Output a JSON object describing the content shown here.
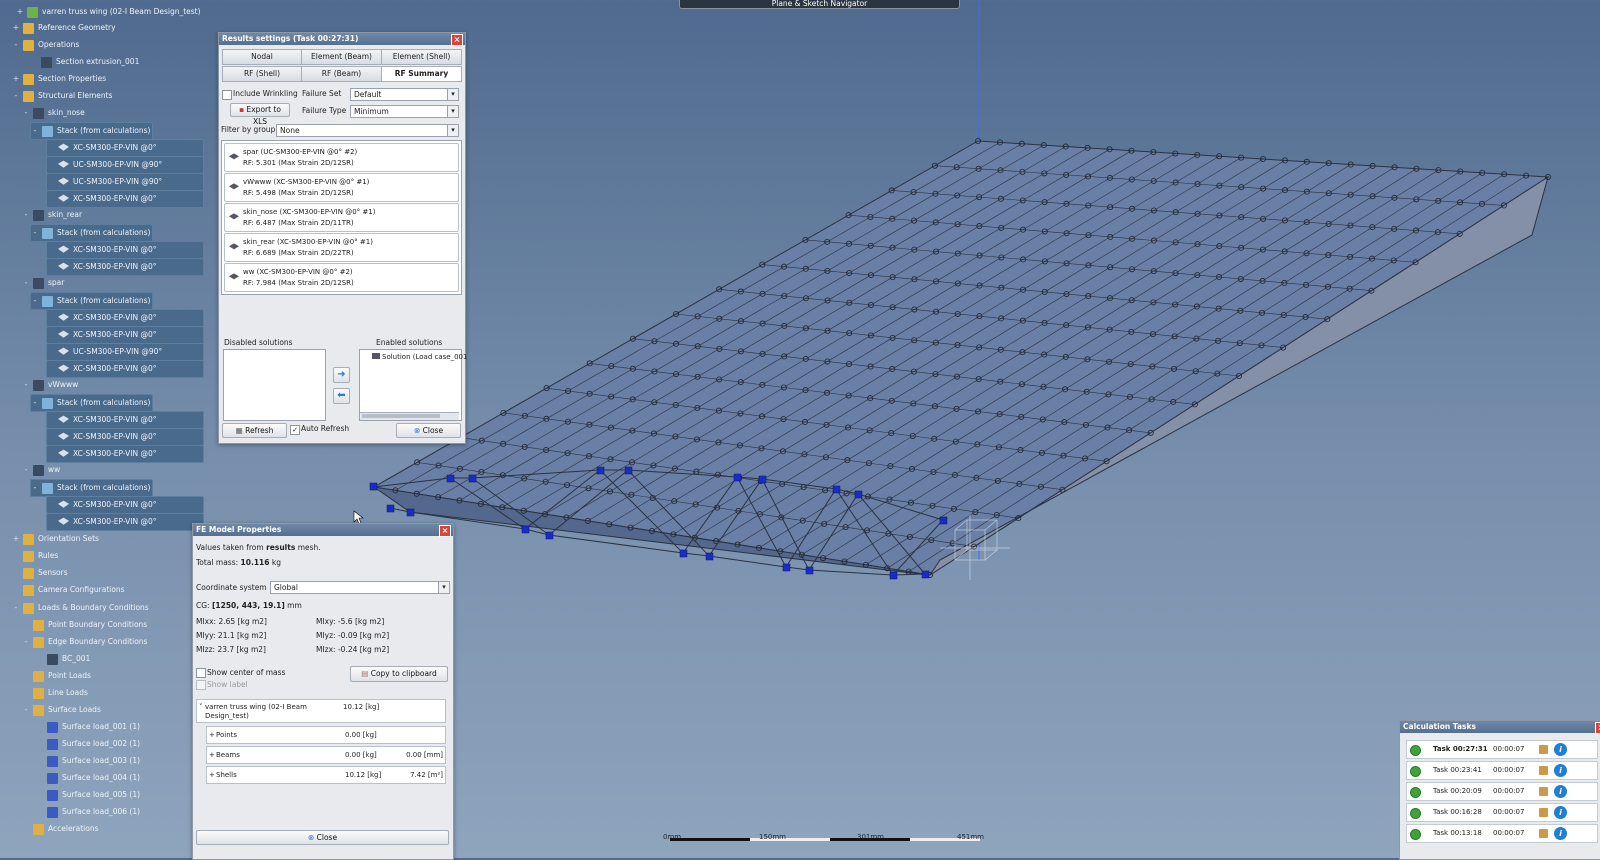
{
  "nav": {
    "title": "Plane & Sketch Navigator"
  },
  "tree": {
    "items": [
      {
        "label": "varren truss wing (02-I Beam Design_test)",
        "icon": "geom"
      },
      {
        "label": "Reference Geometry",
        "icon": "folder"
      },
      {
        "label": "Operations",
        "icon": "folder"
      },
      {
        "label": "Section extrusion_001",
        "icon": "part"
      },
      {
        "label": "Section Properties",
        "icon": "folder"
      },
      {
        "label": "Structural Elements",
        "icon": "folder"
      },
      {
        "label": "skin_nose",
        "icon": "part"
      },
      {
        "label": "Stack (from calculations)",
        "icon": "stack"
      },
      {
        "label": "XC-SM300-EP-VIN @0°",
        "icon": "ply"
      },
      {
        "label": "UC-SM300-EP-VIN @90°",
        "icon": "ply"
      },
      {
        "label": "UC-SM300-EP-VIN @90°",
        "icon": "ply"
      },
      {
        "label": "XC-SM300-EP-VIN @0°",
        "icon": "ply"
      },
      {
        "label": "skin_rear",
        "icon": "part"
      },
      {
        "label": "Stack (from calculations)",
        "icon": "stack"
      },
      {
        "label": "XC-SM300-EP-VIN @0°",
        "icon": "ply"
      },
      {
        "label": "XC-SM300-EP-VIN @0°",
        "icon": "ply"
      },
      {
        "label": "spar",
        "icon": "part"
      },
      {
        "label": "Stack (from calculations)",
        "icon": "stack"
      },
      {
        "label": "XC-SM300-EP-VIN @0°",
        "icon": "ply"
      },
      {
        "label": "XC-SM300-EP-VIN @0°",
        "icon": "ply"
      },
      {
        "label": "UC-SM300-EP-VIN @90°",
        "icon": "ply"
      },
      {
        "label": "XC-SM300-EP-VIN @0°",
        "icon": "ply"
      },
      {
        "label": "vWwww",
        "icon": "part"
      },
      {
        "label": "Stack (from calculations)",
        "icon": "stack"
      },
      {
        "label": "XC-SM300-EP-VIN @0°",
        "icon": "ply"
      },
      {
        "label": "XC-SM300-EP-VIN @0°",
        "icon": "ply"
      },
      {
        "label": "XC-SM300-EP-VIN @0°",
        "icon": "ply"
      },
      {
        "label": "ww",
        "icon": "part"
      },
      {
        "label": "Stack (from calculations)",
        "icon": "stack"
      },
      {
        "label": "XC-SM300-EP-VIN @0°",
        "icon": "ply"
      },
      {
        "label": "XC-SM300-EP-VIN @0°",
        "icon": "ply"
      },
      {
        "label": "Orientation Sets",
        "icon": "folder"
      },
      {
        "label": "Rules",
        "icon": "folder"
      },
      {
        "label": "Sensors",
        "icon": "folder"
      },
      {
        "label": "Camera Configurations",
        "icon": "folder"
      },
      {
        "label": "Loads & Boundary Conditions",
        "icon": "folder"
      },
      {
        "label": "Point Boundary Conditions",
        "icon": "folder"
      },
      {
        "label": "Edge Boundary Conditions",
        "icon": "folder"
      },
      {
        "label": "BC_001",
        "icon": "part"
      },
      {
        "label": "Point Loads",
        "icon": "folder"
      },
      {
        "label": "Line Loads",
        "icon": "folder"
      },
      {
        "label": "Surface Loads",
        "icon": "folder"
      },
      {
        "label": "Surface load_001 (1)",
        "icon": "load"
      },
      {
        "label": "Surface load_002 (1)",
        "icon": "load"
      },
      {
        "label": "Surface load_003 (1)",
        "icon": "load"
      },
      {
        "label": "Surface load_004 (1)",
        "icon": "load"
      },
      {
        "label": "Surface load_005 (1)",
        "icon": "load"
      },
      {
        "label": "Surface load_006 (1)",
        "icon": "load"
      },
      {
        "label": "Accelerations",
        "icon": "folder"
      }
    ]
  },
  "results": {
    "title": "Results settings (Task 00:27:31)",
    "tabs": [
      "Nodal",
      "Element (Beam)",
      "Element (Shell)",
      "RF (Shell)",
      "RF (Beam)",
      "RF Summary"
    ],
    "include_wrinkling": "Include Wrinkling",
    "failure_set_label": "Failure Set",
    "failure_set_value": "Default",
    "export_label": "Export to XLS",
    "failure_type_label": "Failure Type",
    "failure_type_value": "Minimum",
    "filter_label": "Filter by group",
    "filter_value": "None",
    "cards": [
      {
        "line1": "spar (UC-SM300-EP-VIN @0° #2)",
        "line2": "RF: 5.301 (Max Strain 2D/12SR)"
      },
      {
        "line1": "vWwww (XC-SM300-EP-VIN @0° #1)",
        "line2": "RF: 5.498 (Max Strain 2D/12SR)"
      },
      {
        "line1": "skin_nose (XC-SM300-EP-VIN @0° #1)",
        "line2": "RF: 6.487 (Max Strain 2D/11TR)"
      },
      {
        "line1": "skin_rear (XC-SM300-EP-VIN @0° #1)",
        "line2": "RF: 6.689 (Max Strain 2D/22TR)"
      },
      {
        "line1": "ww (XC-SM300-EP-VIN @0° #2)",
        "line2": "RF: 7.984 (Max Strain 2D/12SR)"
      }
    ],
    "disabled_label": "Disabled solutions",
    "enabled_label": "Enabled solutions",
    "enabled_item": "Solution (Load case_001",
    "refresh_label": "Refresh",
    "auto_refresh_label": "Auto Refresh",
    "close_label": "Close"
  },
  "fe": {
    "title": "FE Model Properties",
    "values_note_pre": "Values taken from ",
    "values_note_bold": "results",
    "values_note_post": " mesh.",
    "total_mass_pre": "Total mass: ",
    "total_mass_val": "10.116",
    "total_mass_unit": " kg",
    "coord_label": "Coordinate system",
    "coord_value": "Global",
    "cg_pre": "CG: ",
    "cg_val": "[1250, 443, 19.1]",
    "cg_unit": " mm",
    "mi": {
      "mixx": "MIxx: 2.65 [kg m2]",
      "mixy": "MIxy: -5.6 [kg m2]",
      "miyy": "MIyy: 21.1 [kg m2]",
      "miyz": "MIyz: -0.09 [kg m2]",
      "mizz": "MIzz: 23.7 [kg m2]",
      "mizx": "MIzx: -0.24 [kg m2]"
    },
    "show_com": "Show center of mass",
    "show_label": "Show label",
    "copy_label": "Copy to clipboard",
    "root_name1": "varren truss wing (02-I Beam",
    "root_name2": "Design_test)",
    "root_mass": "10.12 [kg]",
    "rows": [
      {
        "name": "Points",
        "mass": "0.00 [kg]",
        "extra": ""
      },
      {
        "name": "Beams",
        "mass": "0.00 [kg]",
        "extra": "0.00 [mm]"
      },
      {
        "name": "Shells",
        "mass": "10.12 [kg]",
        "extra": "7.42 [m²]"
      }
    ],
    "close_label": "Close"
  },
  "tasks": {
    "title": "Calculation Tasks",
    "rows": [
      {
        "name": "Task 00:27:31",
        "duration": "00:00:07"
      },
      {
        "name": "Task 00:23:41",
        "duration": "00:00:07"
      },
      {
        "name": "Task 00:20:09",
        "duration": "00:00:07"
      },
      {
        "name": "Task 00:16:28",
        "duration": "00:00:07"
      },
      {
        "name": "Task 00:13:18",
        "duration": "00:00:07"
      }
    ]
  },
  "scale": {
    "t0": "0mm",
    "t1": "150mm",
    "t2": "301mm",
    "t3": "451mm"
  },
  "colors": {
    "accent": "#55708f",
    "node_selected": "#1a2cc8",
    "mesh": "#2a3242"
  }
}
